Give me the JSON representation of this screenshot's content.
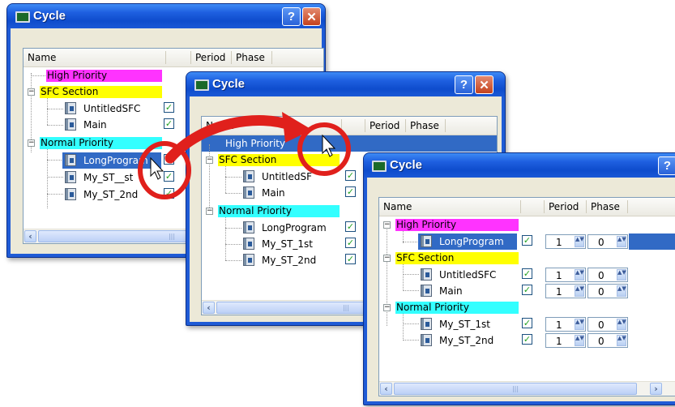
{
  "window_title": "Cycle",
  "help_glyph": "?",
  "close_glyph": "✕",
  "headers": {
    "name": "Name",
    "period": "Period",
    "phase": "Phase"
  },
  "priorities": {
    "high": "High Priority",
    "sfc": "SFC Section",
    "normal": "Normal Priority"
  },
  "programs": {
    "untitled": "UntitledSFC",
    "untitled_truncated": "UntitledSF",
    "main": "Main",
    "long": "LongProgram",
    "long_truncated": "LongProgram",
    "st1": "My_ST_1st",
    "st1_truncated": "My_ST__st",
    "st2": "My_ST_2nd",
    "st2_truncated": "My_ST_2nd"
  },
  "checkmark": "✓",
  "spin_arrows": "▲▼",
  "period_values": [
    "1",
    "1",
    "1",
    "1",
    "1"
  ],
  "phase_values": [
    "0",
    "0",
    "0",
    "0",
    "0"
  ],
  "scroll": {
    "left": "‹",
    "right": "›",
    "thumb": "|||"
  },
  "colors": {
    "high_priority": "#ff33ff",
    "sfc_section": "#ffff00",
    "normal_priority": "#33ffff",
    "selection": "#316ac5",
    "annotation": "#e0201c"
  },
  "icons": [
    "window-icon",
    "help-icon",
    "close-icon",
    "program-icon",
    "checkbox-icon",
    "expander-icon",
    "cursor-icon",
    "drag-arrow-icon"
  ]
}
